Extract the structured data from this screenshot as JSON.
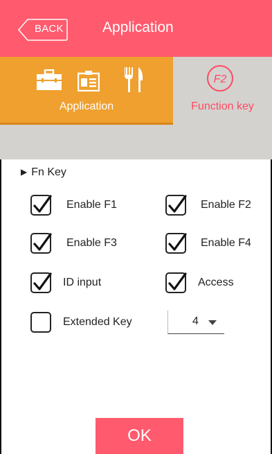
{
  "header": {
    "back_label": "BACK",
    "title": "Application",
    "color": "#ff5a6d"
  },
  "tabs": [
    {
      "label": "Application",
      "active": false,
      "icons": [
        "briefcase-icon",
        "id-card-icon",
        "fork-knife-icon"
      ],
      "color": "#efa02e"
    },
    {
      "label": "Function key",
      "active": true,
      "icons": [
        "f2-icon"
      ],
      "icon_text": "F2",
      "color": "#ff4a63"
    }
  ],
  "section": {
    "title": "Fn Key"
  },
  "checkboxes": [
    {
      "label": "Enable F1",
      "checked": true
    },
    {
      "label": "Enable F2",
      "checked": true
    },
    {
      "label": "Enable F3",
      "checked": true
    },
    {
      "label": "Enable F4",
      "checked": true
    },
    {
      "label": "ID input",
      "checked": true
    },
    {
      "label": "Access",
      "checked": true
    },
    {
      "label": "Extended Key",
      "checked": false
    }
  ],
  "extended_key_select": {
    "value": "4"
  },
  "ok_label": "OK"
}
